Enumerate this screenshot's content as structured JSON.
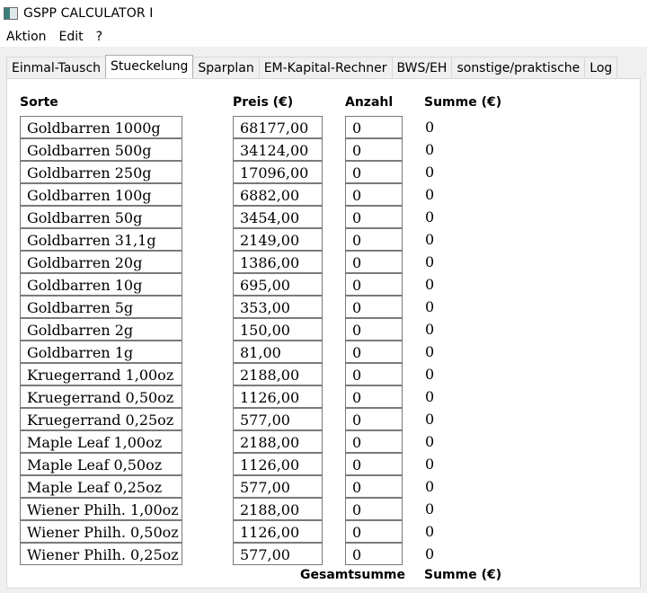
{
  "window": {
    "title": "GSPP CALCULATOR I"
  },
  "menu": [
    "Aktion",
    "Edit",
    "?"
  ],
  "tabs": [
    {
      "label": "Einmal-Tausch",
      "active": false
    },
    {
      "label": "Stueckelung",
      "active": true
    },
    {
      "label": "Sparplan",
      "active": false
    },
    {
      "label": "EM-Kapital-Rechner",
      "active": false
    },
    {
      "label": "BWS/EH",
      "active": false
    },
    {
      "label": "sonstige/praktische",
      "active": false
    },
    {
      "label": "Log",
      "active": false
    }
  ],
  "table": {
    "headers": {
      "sorte": "Sorte",
      "preis": "Preis (€)",
      "anzahl": "Anzahl",
      "summe": "Summe (€)"
    },
    "rows": [
      {
        "sorte": "Goldbarren 1000g",
        "preis": "68177,00",
        "anzahl": "0",
        "summe": "0"
      },
      {
        "sorte": "Goldbarren 500g",
        "preis": "34124,00",
        "anzahl": "0",
        "summe": "0"
      },
      {
        "sorte": "Goldbarren 250g",
        "preis": "17096,00",
        "anzahl": "0",
        "summe": "0"
      },
      {
        "sorte": "Goldbarren 100g",
        "preis": "6882,00",
        "anzahl": "0",
        "summe": "0"
      },
      {
        "sorte": "Goldbarren 50g",
        "preis": "3454,00",
        "anzahl": "0",
        "summe": "0"
      },
      {
        "sorte": "Goldbarren 31,1g",
        "preis": "2149,00",
        "anzahl": "0",
        "summe": "0"
      },
      {
        "sorte": "Goldbarren 20g",
        "preis": "1386,00",
        "anzahl": "0",
        "summe": "0"
      },
      {
        "sorte": "Goldbarren 10g",
        "preis": "695,00",
        "anzahl": "0",
        "summe": "0"
      },
      {
        "sorte": "Goldbarren 5g",
        "preis": "353,00",
        "anzahl": "0",
        "summe": "0"
      },
      {
        "sorte": "Goldbarren 2g",
        "preis": "150,00",
        "anzahl": "0",
        "summe": "0"
      },
      {
        "sorte": "Goldbarren 1g",
        "preis": "81,00",
        "anzahl": "0",
        "summe": "0"
      },
      {
        "sorte": "Kruegerrand 1,00oz",
        "preis": "2188,00",
        "anzahl": "0",
        "summe": "0"
      },
      {
        "sorte": "Kruegerrand 0,50oz",
        "preis": "1126,00",
        "anzahl": "0",
        "summe": "0"
      },
      {
        "sorte": "Kruegerrand 0,25oz",
        "preis": "577,00",
        "anzahl": "0",
        "summe": "0"
      },
      {
        "sorte": "Maple Leaf 1,00oz",
        "preis": "2188,00",
        "anzahl": "0",
        "summe": "0"
      },
      {
        "sorte": "Maple Leaf 0,50oz",
        "preis": "1126,00",
        "anzahl": "0",
        "summe": "0"
      },
      {
        "sorte": "Maple Leaf 0,25oz",
        "preis": "577,00",
        "anzahl": "0",
        "summe": "0"
      },
      {
        "sorte": "Wiener Philh. 1,00oz",
        "preis": "2188,00",
        "anzahl": "0",
        "summe": "0"
      },
      {
        "sorte": "Wiener Philh. 0,50oz",
        "preis": "1126,00",
        "anzahl": "0",
        "summe": "0"
      },
      {
        "sorte": "Wiener Philh. 0,25oz",
        "preis": "577,00",
        "anzahl": "0",
        "summe": "0"
      }
    ]
  },
  "footer": {
    "gesamtsumme_label": "Gesamtsumme",
    "summe_label": "Summe (€)"
  }
}
